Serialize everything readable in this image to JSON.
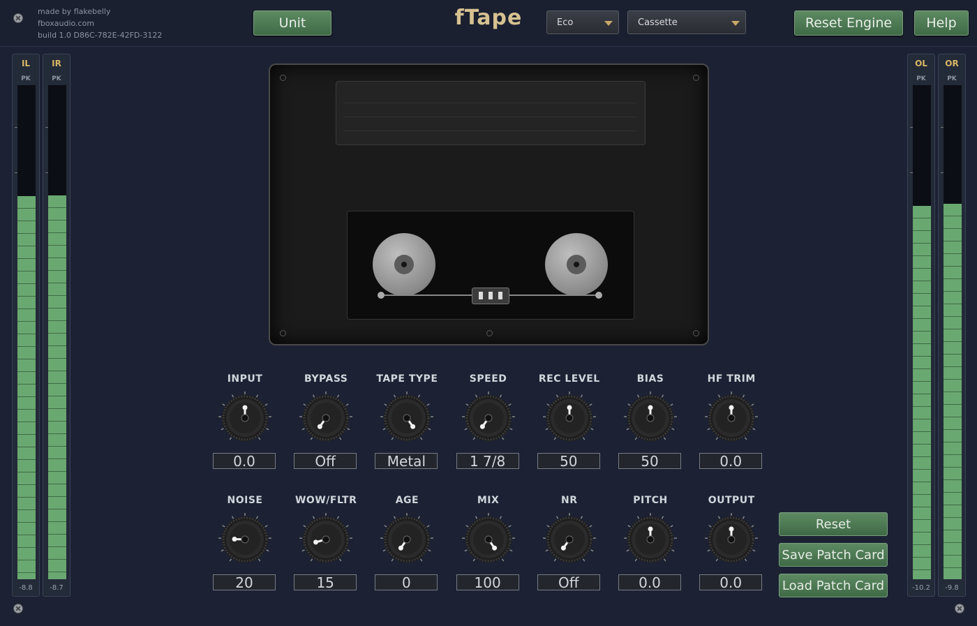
{
  "header": {
    "credit_line1": "made by flakebelly",
    "credit_line2": "fboxaudio.com",
    "credit_line3": "build 1.0  D86C-782E-42FD-3122",
    "unit_label": "Unit",
    "title": "fTape",
    "mode_select": "Eco",
    "type_select": "Cassette",
    "reset_engine_label": "Reset Engine",
    "help_label": "Help"
  },
  "meters": {
    "il": {
      "label": "IL",
      "peak": "PK",
      "value": "-8.8",
      "level": 0.775
    },
    "ir": {
      "label": "IR",
      "peak": "PK",
      "value": "-8.7",
      "level": 0.777
    },
    "ol": {
      "label": "OL",
      "peak": "PK",
      "value": "-10.2",
      "level": 0.755
    },
    "or": {
      "label": "OR",
      "peak": "PK",
      "value": "-9.8",
      "level": 0.76
    }
  },
  "knobs_row1": [
    {
      "label": "INPUT",
      "value": "0.0",
      "angle": 0
    },
    {
      "label": "BYPASS",
      "value": "Off",
      "angle": -145
    },
    {
      "label": "TAPE TYPE",
      "value": "Metal",
      "angle": 145
    },
    {
      "label": "SPEED",
      "value": "1 7/8",
      "angle": -145
    },
    {
      "label": "REC LEVEL",
      "value": "50",
      "angle": 0
    },
    {
      "label": "BIAS",
      "value": "50",
      "angle": 0
    },
    {
      "label": "HF TRIM",
      "value": "0.0",
      "angle": 0
    }
  ],
  "knobs_row2": [
    {
      "label": "NOISE",
      "value": "20",
      "angle": -88
    },
    {
      "label": "WOW/FLTR",
      "value": "15",
      "angle": -105
    },
    {
      "label": "AGE",
      "value": "0",
      "angle": -145
    },
    {
      "label": "MIX",
      "value": "100",
      "angle": 145
    },
    {
      "label": "NR",
      "value": "Off",
      "angle": -145
    },
    {
      "label": "PITCH",
      "value": "0.0",
      "angle": 0
    },
    {
      "label": "OUTPUT",
      "value": "0.0",
      "angle": 0
    }
  ],
  "side_buttons": {
    "reset": "Reset",
    "save": "Save Patch Card",
    "load": "Load Patch Card"
  },
  "colors": {
    "accent_gold": "#d6c190",
    "button_green": "#4d7a54",
    "meter_green": "#6aa871"
  }
}
